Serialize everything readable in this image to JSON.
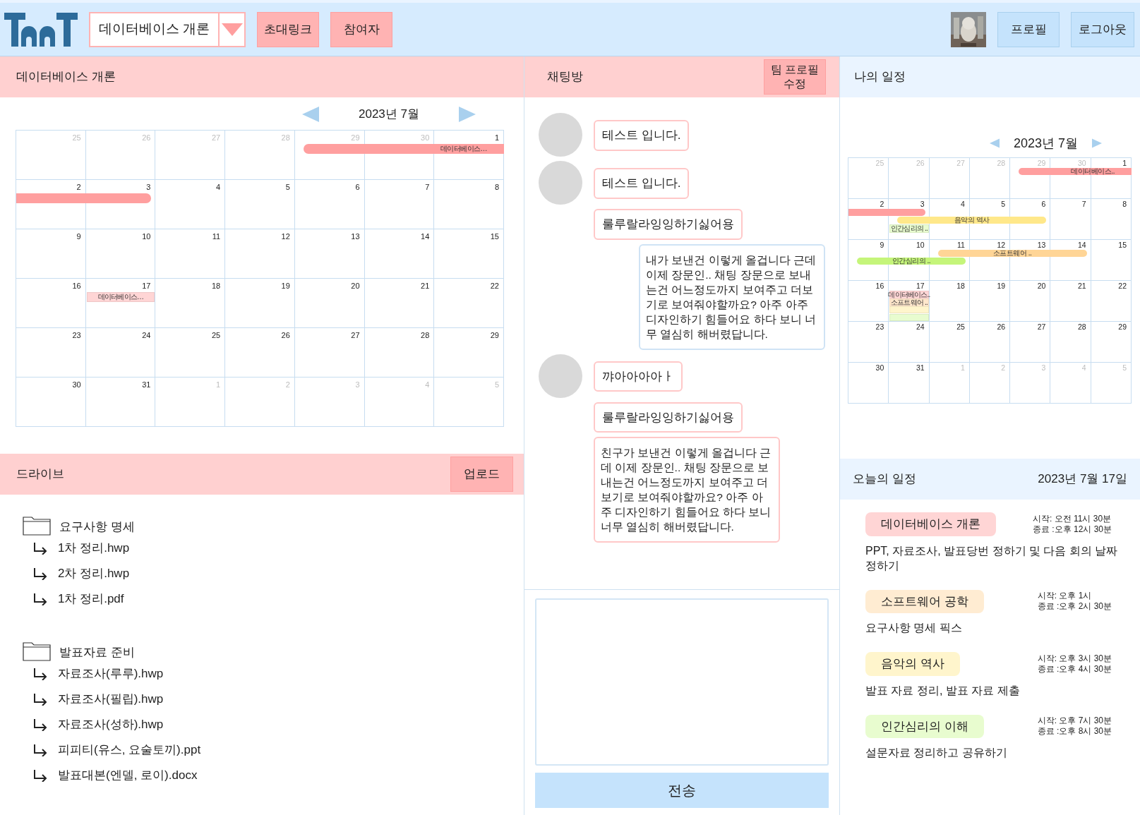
{
  "header": {
    "course_select": {
      "value": "데이터베이스 개론"
    },
    "buttons": [
      "초대링크",
      "참여자"
    ],
    "user_buttons": [
      "프로필",
      "로그아웃"
    ]
  },
  "course_panel": {
    "title": "데이터베이스 개론",
    "calendar": {
      "month": "2023년  7월",
      "weeks": [
        {
          "days": [
            {
              "day": "25",
              "outside": true
            },
            {
              "day": "26",
              "outside": true
            },
            {
              "day": "27",
              "outside": true
            },
            {
              "day": "28",
              "outside": true
            },
            {
              "day": "29",
              "outside": true
            },
            {
              "day": "30",
              "outside": true
            },
            {
              "day": "1",
              "outside": false
            }
          ],
          "lanes": [
            [
              {
                "kind": "none"
              },
              {
                "kind": "none"
              },
              {
                "kind": "none"
              },
              {
                "kind": "none"
              },
              {
                "kind": "bar",
                "label": "데이터베이스…",
                "color": "#ff9f9f",
                "continues_before": false,
                "continues_after": true
              },
              {
                "kind": "continue"
              },
              {
                "kind": "continue"
              }
            ]
          ]
        },
        {
          "days": [
            {
              "day": "2",
              "outside": false
            },
            {
              "day": "3",
              "outside": false
            },
            {
              "day": "4",
              "outside": false
            },
            {
              "day": "5",
              "outside": false
            },
            {
              "day": "6",
              "outside": false
            },
            {
              "day": "7",
              "outside": false
            },
            {
              "day": "8",
              "outside": false
            }
          ],
          "lanes": [
            [
              {
                "kind": "bar",
                "color": "#ff9f9f",
                "continues_before": true,
                "continues_after": false
              },
              {
                "kind": "continue"
              },
              {
                "kind": "none"
              },
              {
                "kind": "none"
              },
              {
                "kind": "none"
              },
              {
                "kind": "none"
              },
              {
                "kind": "none"
              }
            ]
          ]
        },
        {
          "days": [
            {
              "day": "9",
              "outside": false
            },
            {
              "day": "10",
              "outside": false
            },
            {
              "day": "11",
              "outside": false
            },
            {
              "day": "12",
              "outside": false
            },
            {
              "day": "13",
              "outside": false
            },
            {
              "day": "14",
              "outside": false
            },
            {
              "day": "15",
              "outside": false
            }
          ]
        },
        {
          "days": [
            {
              "day": "16",
              "outside": false
            },
            {
              "day": "17",
              "outside": false
            },
            {
              "day": "18",
              "outside": false
            },
            {
              "day": "19",
              "outside": false
            },
            {
              "day": "20",
              "outside": false
            },
            {
              "day": "21",
              "outside": false
            },
            {
              "day": "22",
              "outside": false
            }
          ],
          "lanes": [
            [
              {
                "kind": "none"
              },
              {
                "kind": "chip",
                "label": "데이터베이스…",
                "color": "#ffd5d5"
              },
              {
                "kind": "none"
              },
              {
                "kind": "none"
              },
              {
                "kind": "none"
              },
              {
                "kind": "none"
              },
              {
                "kind": "none"
              }
            ]
          ]
        },
        {
          "days": [
            {
              "day": "23",
              "outside": false
            },
            {
              "day": "24",
              "outside": false
            },
            {
              "day": "25",
              "outside": false
            },
            {
              "day": "26",
              "outside": false
            },
            {
              "day": "27",
              "outside": false
            },
            {
              "day": "28",
              "outside": false
            },
            {
              "day": "29",
              "outside": false
            }
          ]
        },
        {
          "days": [
            {
              "day": "30",
              "outside": false
            },
            {
              "day": "31",
              "outside": false
            },
            {
              "day": "1",
              "outside": true
            },
            {
              "day": "2",
              "outside": true
            },
            {
              "day": "3",
              "outside": true
            },
            {
              "day": "4",
              "outside": true
            },
            {
              "day": "5",
              "outside": true
            }
          ]
        }
      ]
    }
  },
  "drive": {
    "title": "드라이브",
    "upload_button": "업로드",
    "tree": [
      {
        "name": "요구사항 명세",
        "children": [
          {
            "name": "1차 정리.hwp"
          },
          {
            "name": "2차 정리.hwp"
          },
          {
            "name": "1차 정리.pdf"
          }
        ]
      },
      {
        "name": "발표자료 준비",
        "children": [
          {
            "name": "자료조사(루루).hwp"
          },
          {
            "name": "자료조사(필립).hwp"
          },
          {
            "name": "자료조사(성하).hwp"
          },
          {
            "name": "피피티(유스, 요술토끼).ppt"
          },
          {
            "name": "발표대본(엔델, 로이).docx"
          }
        ]
      }
    ]
  },
  "chat": {
    "title": "채팅방",
    "edit_button": "팀 프로필 수정",
    "messages": [
      {
        "kind": "theirs",
        "avatar": true,
        "text": "테스트 입니다."
      },
      {
        "kind": "theirs",
        "avatar": true,
        "text": "테스트 입니다."
      },
      {
        "kind": "theirs",
        "avatar": false,
        "text": "룰루랄라잉잉하기싫어용"
      },
      {
        "kind": "mine",
        "text": "내가 보낸건 이렇게 올겁니다 근데 이제 장문인.. 채팅 장문으로 보내는건 어느정도까지 보여주고 더보기로 보여줘야할까요? 아주 아주 디자인하기 힘들어요 하다 보니 너무 열심히 해버렸답니다."
      },
      {
        "kind": "theirs",
        "avatar": true,
        "text": "꺄아아아아ㅏ"
      },
      {
        "kind": "theirs",
        "avatar": false,
        "text": "룰루랄라잉잉하기싫어용"
      },
      {
        "kind": "theirs",
        "avatar": false,
        "text": "친구가 보낸건 이렇게 올겁니다 근데 이제 장문인.. 채팅 장문으로 보내는건 어느정도까지 보여주고 더보기로 보여줘야할까요? 아주 아주 디자인하기 힘들어요 하다 보니 너무 열심히 해버렸답니다."
      }
    ],
    "send_button": "전송"
  },
  "my_schedule": {
    "title": "나의 일정",
    "calendar": {
      "month": "2023년  7월",
      "weeks": [
        {
          "days": [
            {
              "day": "25",
              "outside": true
            },
            {
              "day": "26",
              "outside": true
            },
            {
              "day": "27",
              "outside": true
            },
            {
              "day": "28",
              "outside": true
            },
            {
              "day": "29",
              "outside": true
            },
            {
              "day": "30",
              "outside": true
            },
            {
              "day": "1",
              "outside": false
            }
          ],
          "lanes": [
            [
              {
                "kind": "none"
              },
              {
                "kind": "none"
              },
              {
                "kind": "none"
              },
              {
                "kind": "none"
              },
              {
                "kind": "bar",
                "label": "데이터베이스..",
                "color": "#ff9f9f",
                "continues_before": false,
                "continues_after": true
              },
              {
                "kind": "continue"
              },
              {
                "kind": "continue"
              }
            ]
          ]
        },
        {
          "days": [
            {
              "day": "2",
              "outside": false
            },
            {
              "day": "3",
              "outside": false
            },
            {
              "day": "4",
              "outside": false
            },
            {
              "day": "5",
              "outside": false
            },
            {
              "day": "6",
              "outside": false
            },
            {
              "day": "7",
              "outside": false
            },
            {
              "day": "8",
              "outside": false
            }
          ],
          "lanes": [
            [
              {
                "kind": "bar",
                "color": "#ff9f9f",
                "continues_before": true,
                "continues_after": false
              },
              {
                "kind": "continue"
              },
              {
                "kind": "none"
              },
              {
                "kind": "none"
              },
              {
                "kind": "none"
              },
              {
                "kind": "none"
              },
              {
                "kind": "none"
              }
            ],
            [
              {
                "kind": "none"
              },
              {
                "kind": "bar",
                "label": "음악의 역사",
                "color": "#ffe88a",
                "continues_before": false,
                "continues_after": false
              },
              {
                "kind": "continue"
              },
              {
                "kind": "continue"
              },
              {
                "kind": "continue"
              },
              {
                "kind": "none"
              },
              {
                "kind": "none"
              }
            ],
            [
              {
                "kind": "none"
              },
              {
                "kind": "chip",
                "label": "인간심리의 ..",
                "color": "#e8fccf"
              },
              {
                "kind": "none"
              },
              {
                "kind": "none"
              },
              {
                "kind": "none"
              },
              {
                "kind": "none"
              },
              {
                "kind": "none"
              }
            ]
          ]
        },
        {
          "days": [
            {
              "day": "9",
              "outside": false
            },
            {
              "day": "10",
              "outside": false
            },
            {
              "day": "11",
              "outside": false
            },
            {
              "day": "12",
              "outside": false
            },
            {
              "day": "13",
              "outside": false
            },
            {
              "day": "14",
              "outside": false
            },
            {
              "day": "15",
              "outside": false
            }
          ],
          "lanes": [
            [
              {
                "kind": "none"
              },
              {
                "kind": "none"
              },
              {
                "kind": "bar",
                "label": "소프트웨어 ..",
                "color": "#ffd596",
                "continues_before": false,
                "continues_after": false
              },
              {
                "kind": "continue"
              },
              {
                "kind": "continue"
              },
              {
                "kind": "continue"
              },
              {
                "kind": "none"
              }
            ],
            [
              {
                "kind": "bar",
                "label": "인간심리의 ..",
                "color": "#c5f57a",
                "continues_before": false,
                "continues_after": false
              },
              {
                "kind": "continue"
              },
              {
                "kind": "continue"
              },
              {
                "kind": "none"
              },
              {
                "kind": "none"
              },
              {
                "kind": "none"
              },
              {
                "kind": "none"
              }
            ]
          ]
        },
        {
          "days": [
            {
              "day": "16",
              "outside": false
            },
            {
              "day": "17",
              "outside": false
            },
            {
              "day": "18",
              "outside": false
            },
            {
              "day": "19",
              "outside": false
            },
            {
              "day": "20",
              "outside": false
            },
            {
              "day": "21",
              "outside": false
            },
            {
              "day": "22",
              "outside": false
            }
          ],
          "lanes": [
            [
              {
                "kind": "none"
              },
              {
                "kind": "chip",
                "label": "데이터베이스..",
                "color": "#ffd5d5"
              },
              {
                "kind": "none"
              },
              {
                "kind": "none"
              },
              {
                "kind": "none"
              },
              {
                "kind": "none"
              },
              {
                "kind": "none"
              }
            ],
            [
              {
                "kind": "none"
              },
              {
                "kind": "chip",
                "label": "소프트웨어 ..",
                "color": "#ffe7cc"
              },
              {
                "kind": "none"
              },
              {
                "kind": "none"
              },
              {
                "kind": "none"
              },
              {
                "kind": "none"
              },
              {
                "kind": "none"
              }
            ],
            [
              {
                "kind": "none"
              },
              {
                "kind": "chip",
                "color": "#fff5cc"
              },
              {
                "kind": "none"
              },
              {
                "kind": "none"
              },
              {
                "kind": "none"
              },
              {
                "kind": "none"
              },
              {
                "kind": "none"
              }
            ],
            [
              {
                "kind": "none"
              },
              {
                "kind": "chip",
                "color": "#e8fccf"
              },
              {
                "kind": "none"
              },
              {
                "kind": "none"
              },
              {
                "kind": "none"
              },
              {
                "kind": "none"
              },
              {
                "kind": "none"
              }
            ]
          ]
        },
        {
          "days": [
            {
              "day": "23",
              "outside": false
            },
            {
              "day": "24",
              "outside": false
            },
            {
              "day": "25",
              "outside": false
            },
            {
              "day": "26",
              "outside": false
            },
            {
              "day": "27",
              "outside": false
            },
            {
              "day": "28",
              "outside": false
            },
            {
              "day": "29",
              "outside": false
            }
          ]
        },
        {
          "days": [
            {
              "day": "30",
              "outside": false
            },
            {
              "day": "31",
              "outside": false
            },
            {
              "day": "1",
              "outside": true
            },
            {
              "day": "2",
              "outside": true
            },
            {
              "day": "3",
              "outside": true
            },
            {
              "day": "4",
              "outside": true
            },
            {
              "day": "5",
              "outside": true
            }
          ]
        }
      ]
    }
  },
  "today": {
    "title": "오늘의 일정",
    "date": "2023년  7월 17일",
    "items": [
      {
        "title": "데이터베이스 개론",
        "color": "#ffd5d5",
        "start": "시작: 오전 11시 30분",
        "end": "종료 :오후 12시 30분",
        "note": "PPT, 자료조사, 발표당번 정하기 및 다음 회의 날짜 정하기"
      },
      {
        "title": "소프트웨어 공학",
        "color": "#ffecd2",
        "start": "시작: 오후 1시",
        "end": "종료 :오후 2시 30분",
        "note": "요구사항 명세 픽스"
      },
      {
        "title": "음악의 역사",
        "color": "#fff5cc",
        "start": "시작: 오후 3시 30분",
        "end": "종료 :오후 4시 30분",
        "note": "발표 자료 정리, 발표 자료 제출"
      },
      {
        "title": "인간심리의 이해",
        "color": "#e8fccf",
        "start": "시작: 오후 7시 30분",
        "end": "종료 :오후 8시 30분",
        "note": "설문자료 정리하고 공유하기"
      }
    ]
  }
}
